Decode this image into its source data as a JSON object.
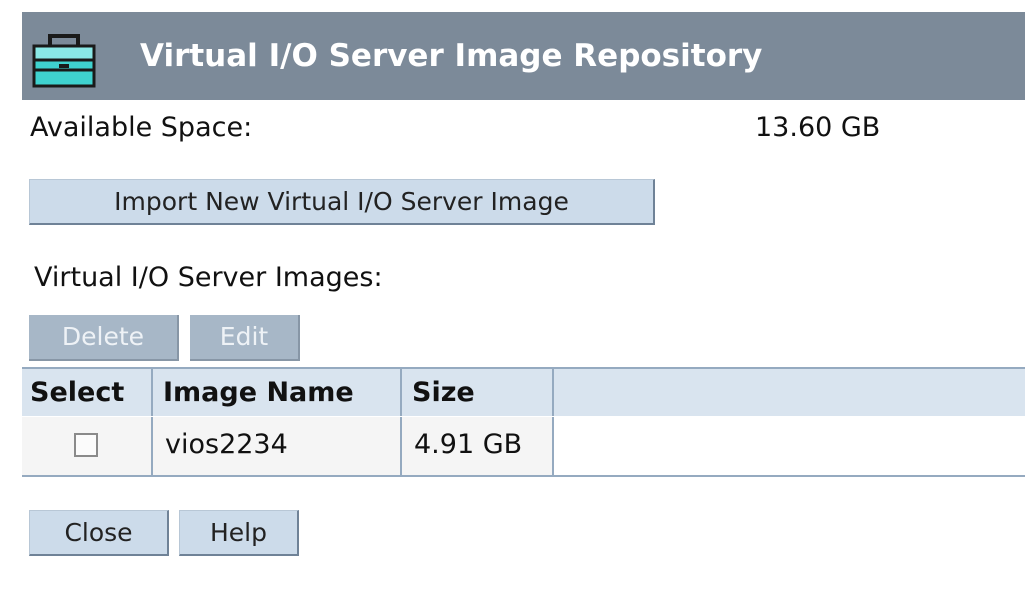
{
  "header": {
    "title": "Virtual I/O Server Image Repository",
    "icon": "toolbox-icon"
  },
  "storage": {
    "available_label": "Available Space:",
    "available_value": "13.60 GB"
  },
  "actions": {
    "import_label": "Import New Virtual I/O Server Image"
  },
  "images_section": {
    "label": "Virtual I/O Server Images:",
    "delete_label": "Delete",
    "edit_label": "Edit",
    "columns": [
      "Select",
      "Image Name",
      "Size"
    ],
    "rows": [
      {
        "selected": false,
        "name": "vios2234",
        "size": "4.91 GB"
      }
    ]
  },
  "footer": {
    "close_label": "Close",
    "help_label": "Help"
  },
  "colors": {
    "titlebar": "#7c8a99",
    "button": "#ccdbea",
    "button_disabled": "#a7b7c7",
    "table_header": "#d9e4ef",
    "border": "#95aac0"
  }
}
